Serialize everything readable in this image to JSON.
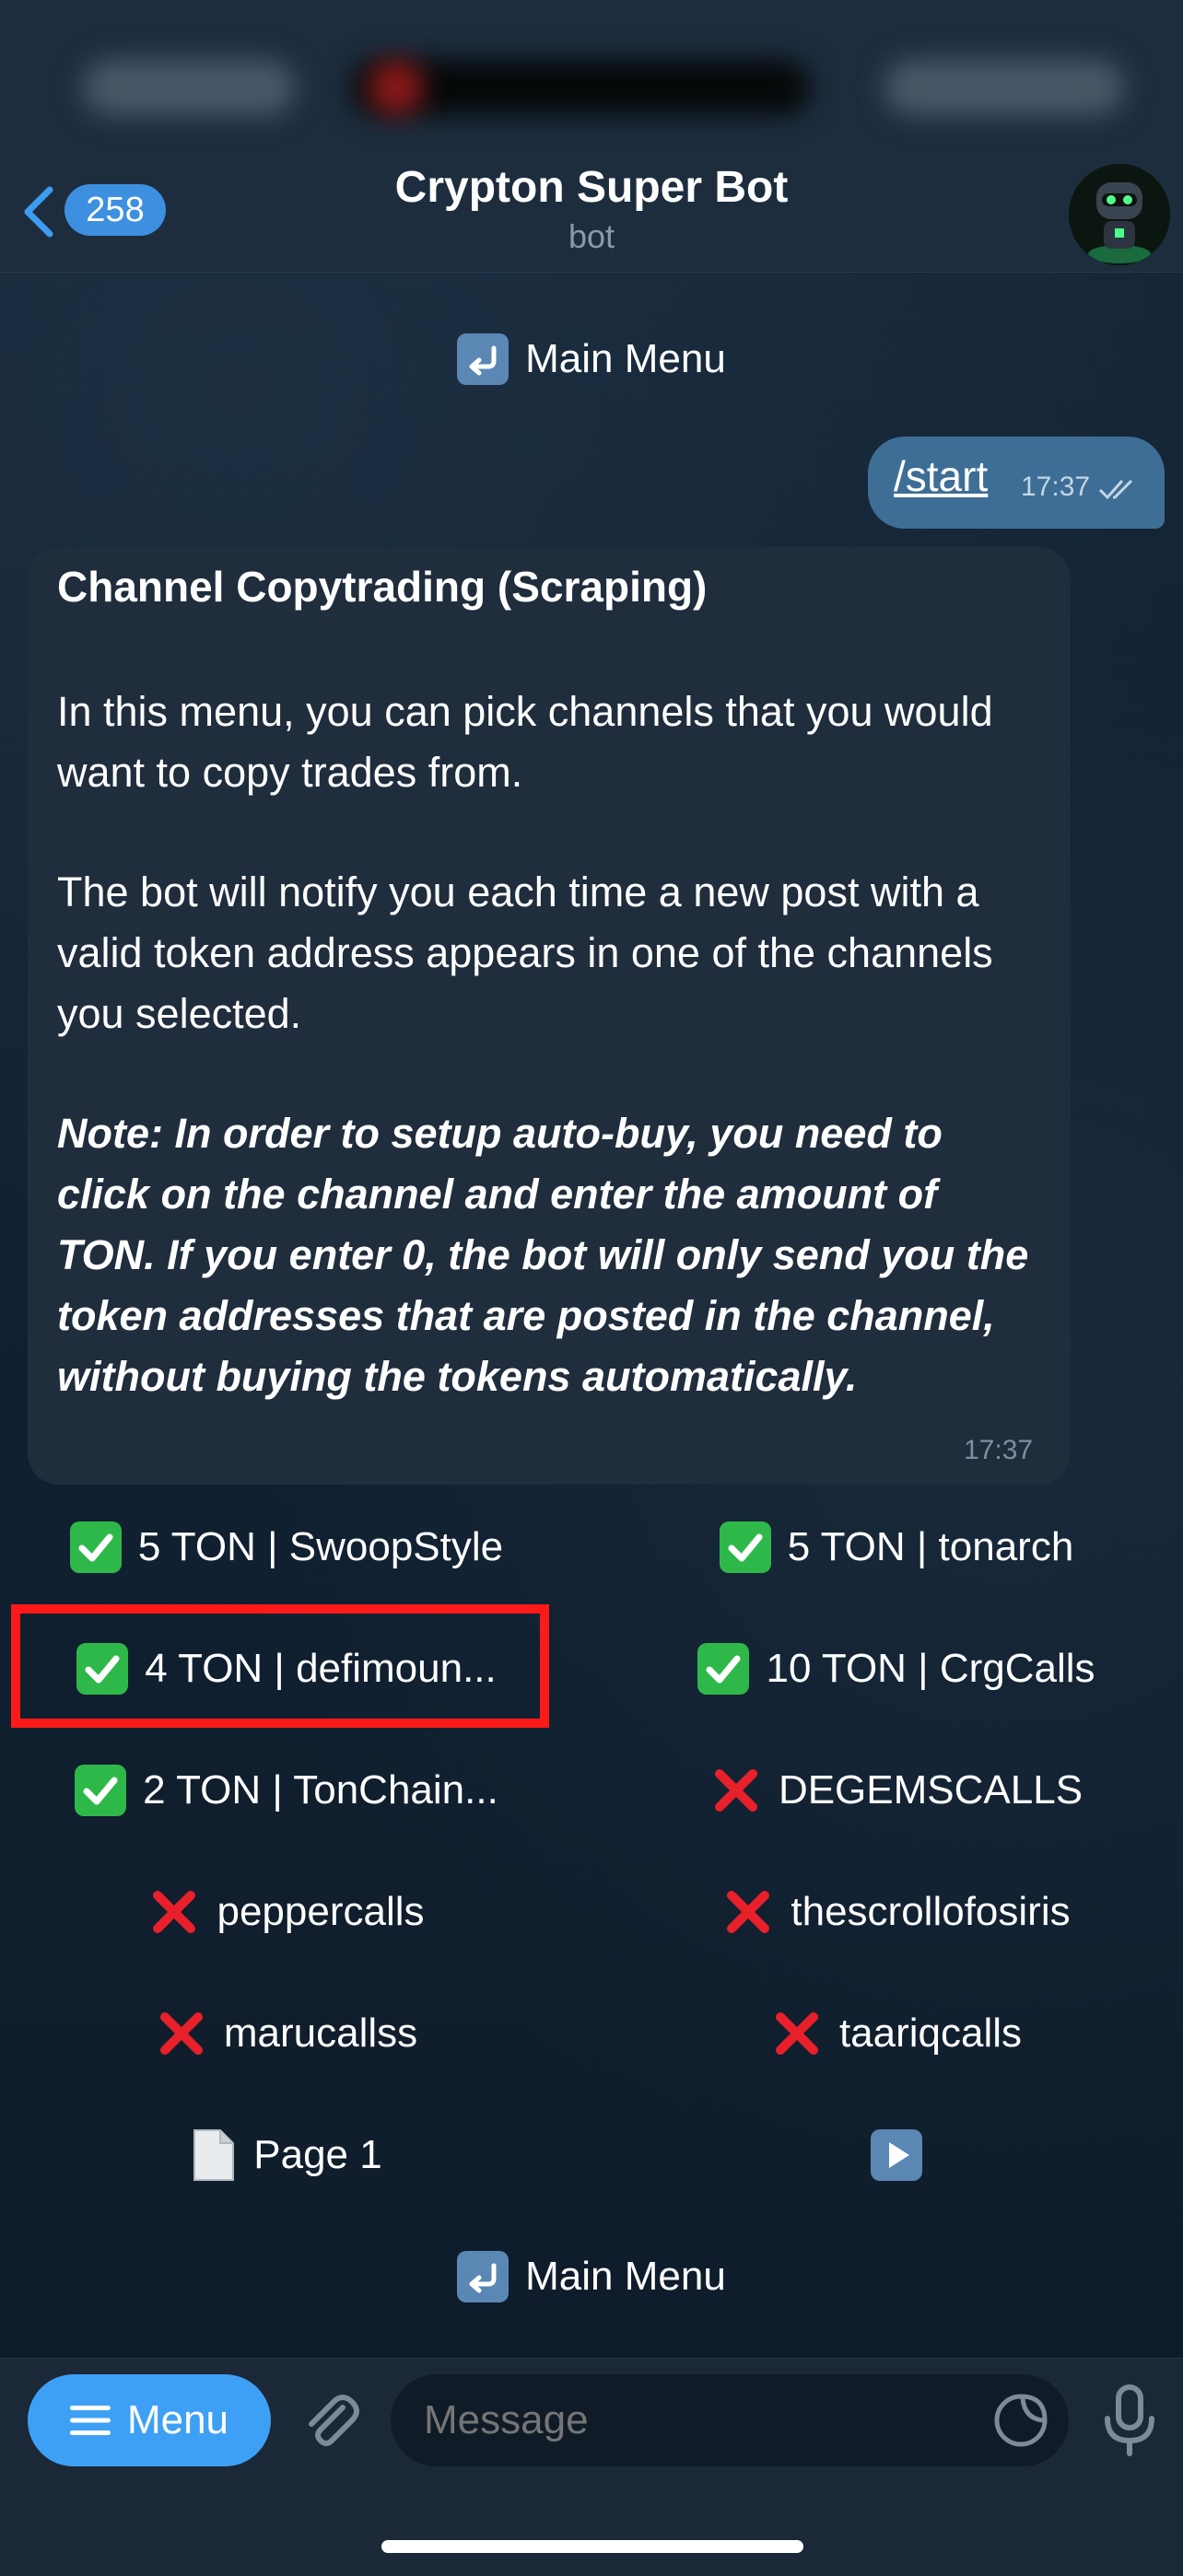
{
  "header": {
    "back_count": "258",
    "title": "Crypton Super Bot",
    "subtitle": "bot"
  },
  "top_menu_button": {
    "label": "Main Menu",
    "icon": "return-arrow-icon"
  },
  "outgoing_message": {
    "text": "/start",
    "time": "17:37",
    "status_icon": "double-check-icon"
  },
  "incoming_message": {
    "title": "Channel Copytrading (Scraping)",
    "para1": "In this menu, you can pick channels that you would want to copy trades from.",
    "para2": "The bot will notify you each time a new post with a valid token address appears in one of the channels you selected.",
    "note": "Note: In order to setup auto-buy, you need to click on the channel and enter the amount of TON. If you enter 0, the bot will only send you the token addresses that are posted in the channel, without buying the tokens automatically.",
    "time": "17:37"
  },
  "keyboard": {
    "rows": [
      [
        {
          "label": "5 TON |  SwoopStyle",
          "status": "enabled"
        },
        {
          "label": "5 TON |  tonarch",
          "status": "enabled"
        }
      ],
      [
        {
          "label": "4 TON |  defimoun...",
          "status": "enabled"
        },
        {
          "label": "10 TON |  CrgCalls",
          "status": "enabled"
        }
      ],
      [
        {
          "label": "2 TON |  TonChain...",
          "status": "enabled"
        },
        {
          "label": "DEGEMSCALLS",
          "status": "disabled"
        }
      ],
      [
        {
          "label": "peppercalls",
          "status": "disabled"
        },
        {
          "label": "thescrollofosiris",
          "status": "disabled"
        }
      ],
      [
        {
          "label": "marucallss",
          "status": "disabled"
        },
        {
          "label": "taariqcalls",
          "status": "disabled"
        }
      ]
    ],
    "page_label": "Page 1",
    "page_icon": "page-document-icon",
    "next_icon": "play-next-icon",
    "main_menu_label": "Main Menu"
  },
  "bottom_bar": {
    "menu_label": "Menu",
    "message_placeholder": "Message"
  },
  "colors": {
    "accent": "#3ea0f5",
    "check_green": "#2fb84a",
    "cross_red": "#e8202a",
    "highlight_red": "#ff1a1a",
    "out_bubble": "#3e6e96",
    "in_bubble": "#1f2d3d"
  }
}
